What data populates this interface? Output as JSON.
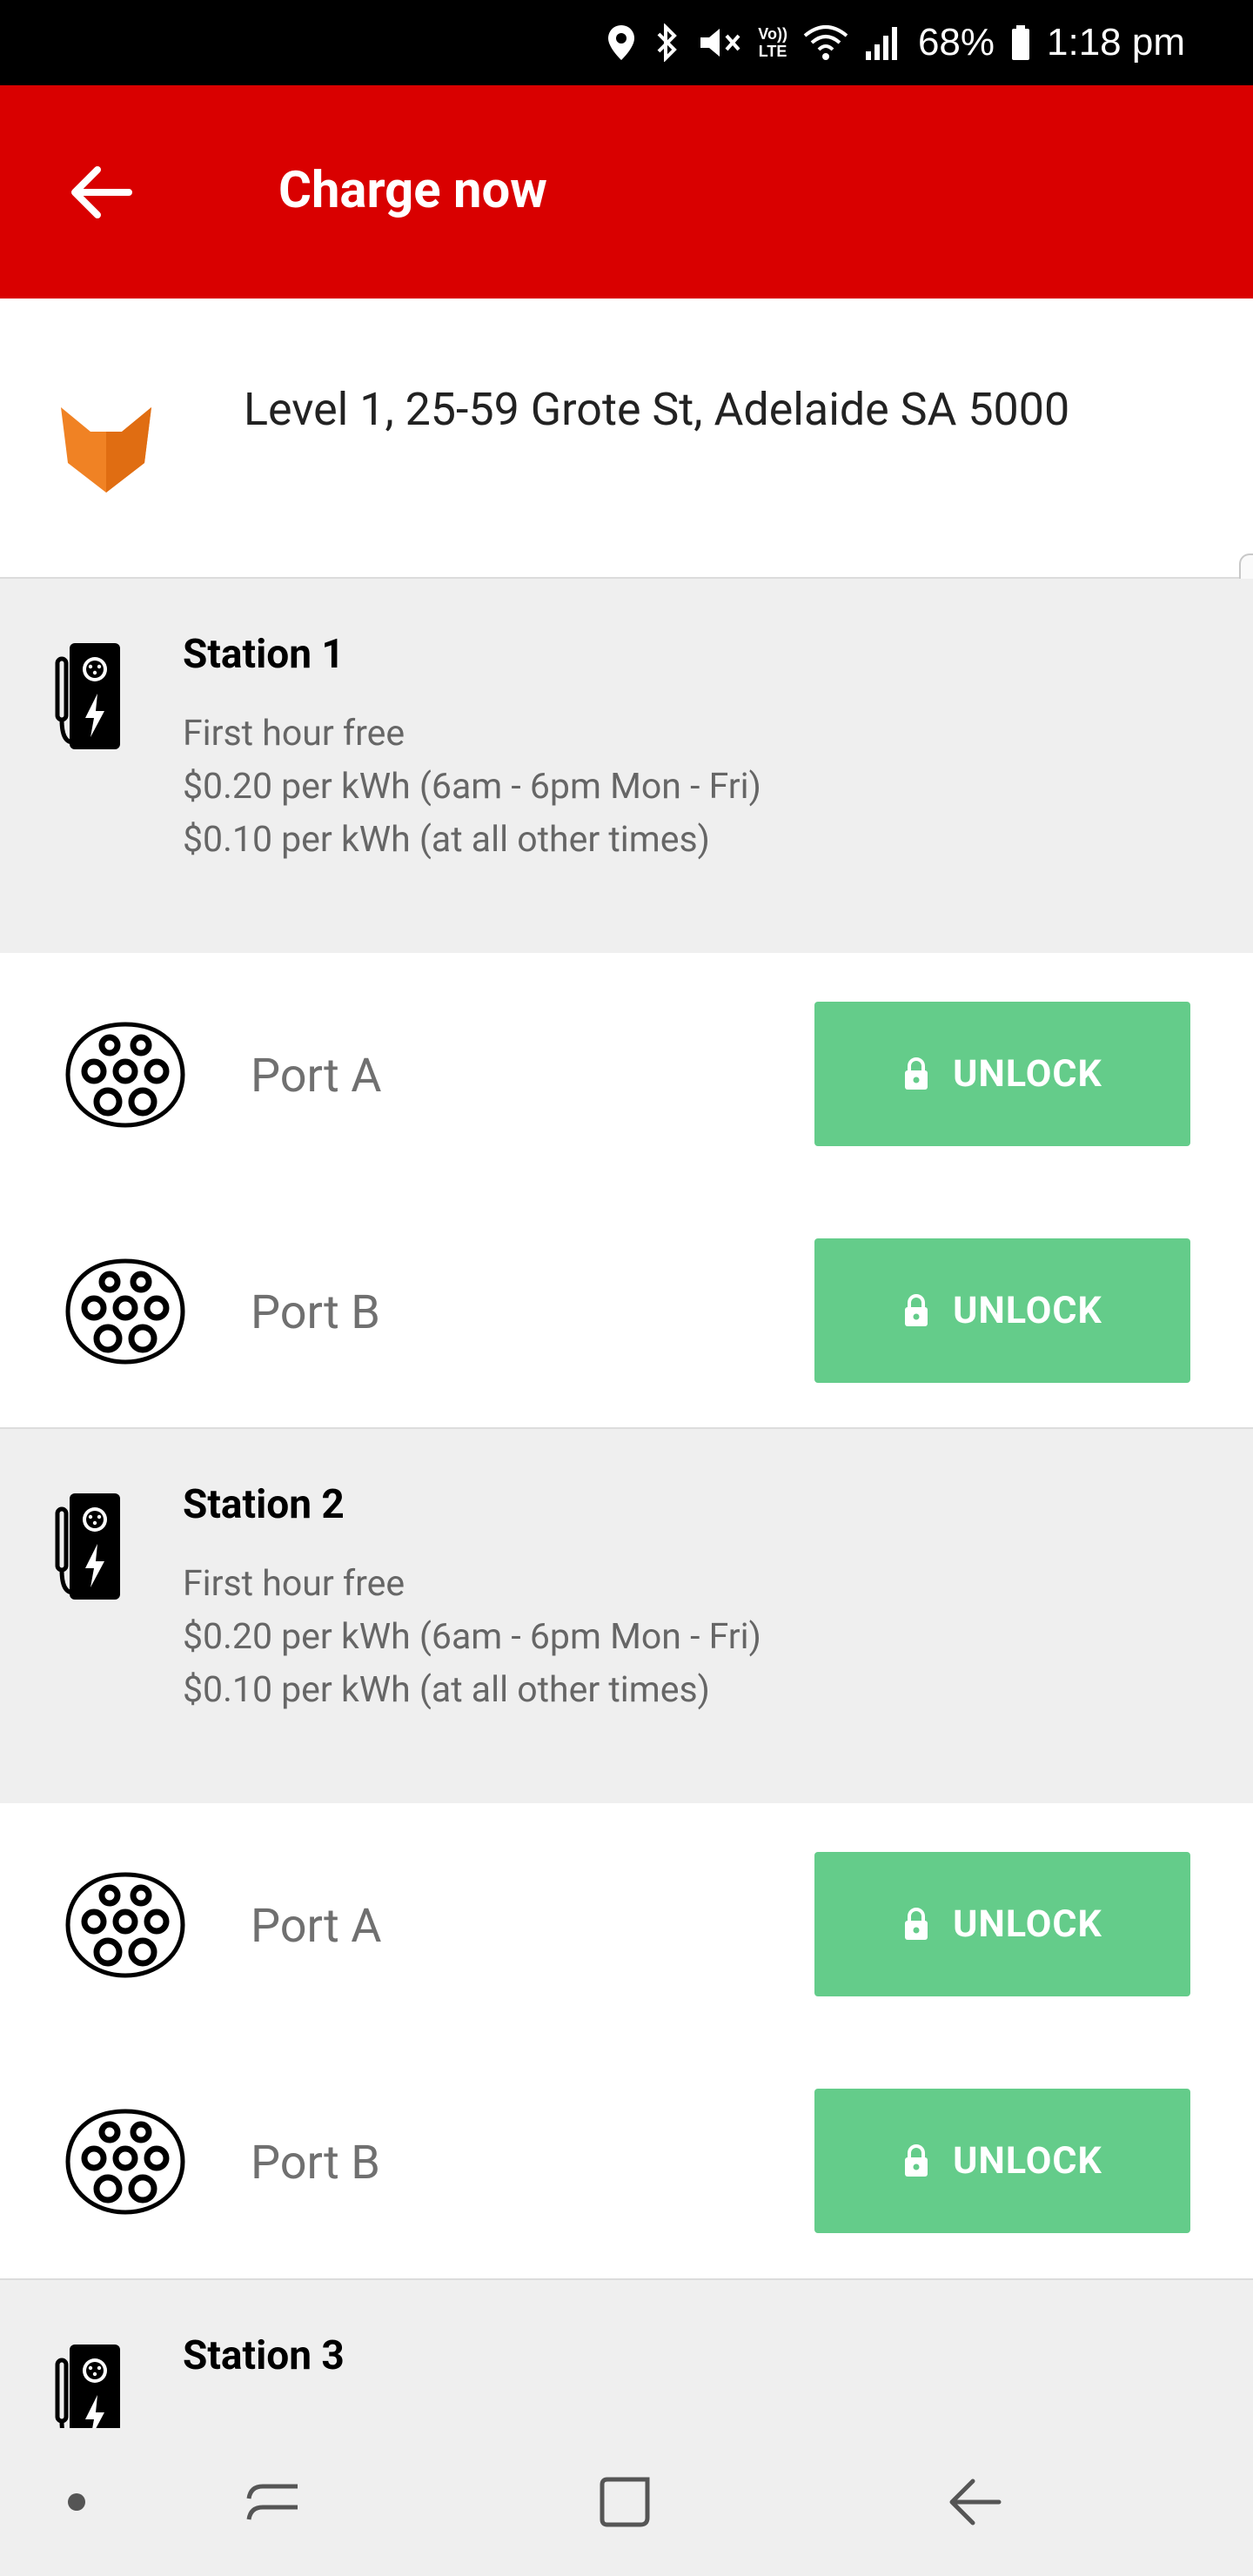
{
  "status_bar": {
    "battery": "68%",
    "time": "1:18 pm",
    "lte": "LTE",
    "volte": "Vo))"
  },
  "app_bar": {
    "title": "Charge now"
  },
  "location": {
    "address": "Level 1, 25-59 Grote St, Adelaide SA 5000"
  },
  "colors": {
    "app_bar": "#d90000",
    "unlock_button": "#64cc8a",
    "logo_orange": "#f08224"
  },
  "stations": [
    {
      "name": "Station 1",
      "rates": [
        "First hour free",
        "$0.20 per kWh (6am - 6pm Mon - Fri)",
        "$0.10 per kWh (at all other times)"
      ],
      "ports": [
        {
          "label": "Port A",
          "button": "UNLOCK"
        },
        {
          "label": "Port B",
          "button": "UNLOCK"
        }
      ]
    },
    {
      "name": "Station 2",
      "rates": [
        "First hour free",
        "$0.20 per kWh (6am - 6pm Mon - Fri)",
        "$0.10 per kWh (at all other times)"
      ],
      "ports": [
        {
          "label": "Port A",
          "button": "UNLOCK"
        },
        {
          "label": "Port B",
          "button": "UNLOCK"
        }
      ]
    },
    {
      "name": "Station 3"
    }
  ]
}
